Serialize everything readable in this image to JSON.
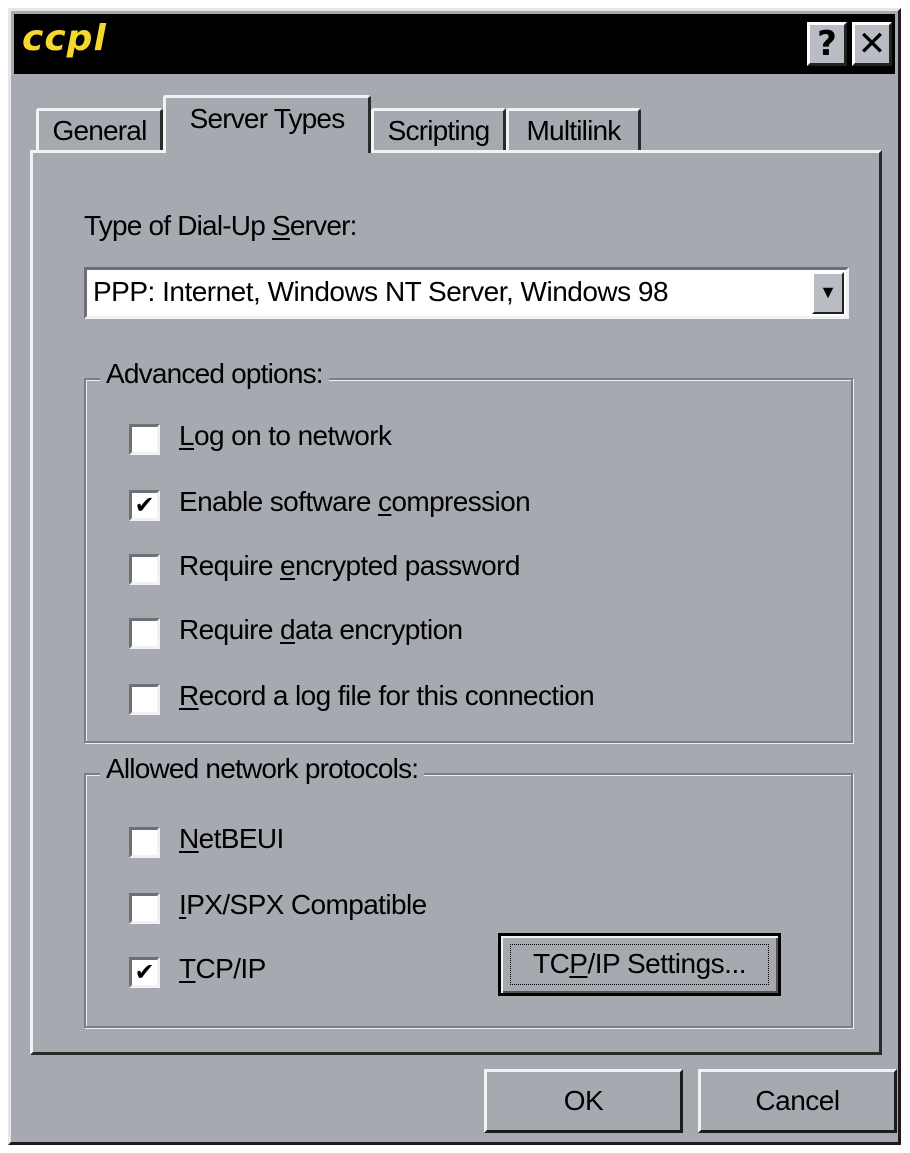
{
  "window": {
    "title": "ccpl"
  },
  "titlebar": {
    "help_label": "?",
    "close_label": "✕"
  },
  "tabs": [
    {
      "label": "General",
      "active": false
    },
    {
      "label": "Server Types",
      "active": true
    },
    {
      "label": "Scripting",
      "active": false
    },
    {
      "label": "Multilink",
      "active": false
    }
  ],
  "server": {
    "label_pre": "Type of Dial-Up ",
    "label_key": "S",
    "label_post": "erver:",
    "selected": "PPP: Internet, Windows NT Server, Windows 98",
    "dropdown_glyph": "▼"
  },
  "advanced": {
    "title": "Advanced options:",
    "options": [
      {
        "pre": "",
        "key": "L",
        "post": "og on to network",
        "checked": false
      },
      {
        "pre": "Enable software ",
        "key": "c",
        "post": "ompression",
        "checked": true
      },
      {
        "pre": "Require ",
        "key": "e",
        "post": "ncrypted password",
        "checked": false
      },
      {
        "pre": "Require ",
        "key": "d",
        "post": "ata encryption",
        "checked": false
      },
      {
        "pre": "",
        "key": "R",
        "post": "ecord a log file for this connection",
        "checked": false
      }
    ]
  },
  "protocols": {
    "title": "Allowed network protocols:",
    "options": [
      {
        "pre": "",
        "key": "N",
        "post": "etBEUI",
        "checked": false
      },
      {
        "pre": "",
        "key": "I",
        "post": "PX/SPX Compatible",
        "checked": false
      },
      {
        "pre": "",
        "key": "T",
        "post": "CP/IP",
        "checked": true
      }
    ],
    "settings_pre": "TC",
    "settings_key": "P",
    "settings_post": "/IP Settings..."
  },
  "check_glyph": "✔",
  "footer": {
    "ok_label": "OK",
    "cancel_label": "Cancel"
  }
}
